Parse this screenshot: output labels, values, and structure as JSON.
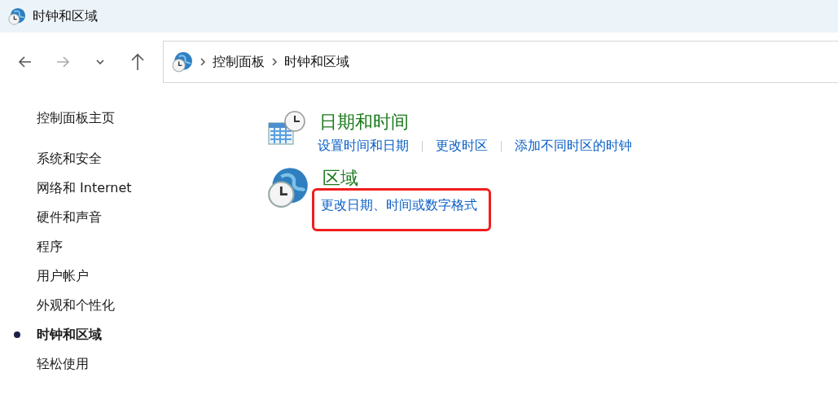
{
  "window": {
    "title": "时钟和区域"
  },
  "address_bar": {
    "breadcrumbs": [
      "控制面板",
      "时钟和区域"
    ]
  },
  "sidebar": {
    "home": "控制面板主页",
    "items": [
      {
        "label": "系统和安全",
        "selected": false
      },
      {
        "label": "网络和 Internet",
        "selected": false
      },
      {
        "label": "硬件和声音",
        "selected": false
      },
      {
        "label": "程序",
        "selected": false
      },
      {
        "label": "用户帐户",
        "selected": false
      },
      {
        "label": "外观和个性化",
        "selected": false
      },
      {
        "label": "时钟和区域",
        "selected": true
      },
      {
        "label": "轻松使用",
        "selected": false
      }
    ]
  },
  "categories": [
    {
      "kind": "datetime",
      "title": "日期和时间",
      "links": [
        {
          "label": "设置时间和日期",
          "highlighted": false
        },
        {
          "label": "更改时区",
          "highlighted": false
        },
        {
          "label": "添加不同时区的时钟",
          "highlighted": false
        }
      ]
    },
    {
      "kind": "region",
      "title": "区域",
      "links": [
        {
          "label": "更改日期、时间或数字格式",
          "highlighted": true
        }
      ]
    }
  ]
}
